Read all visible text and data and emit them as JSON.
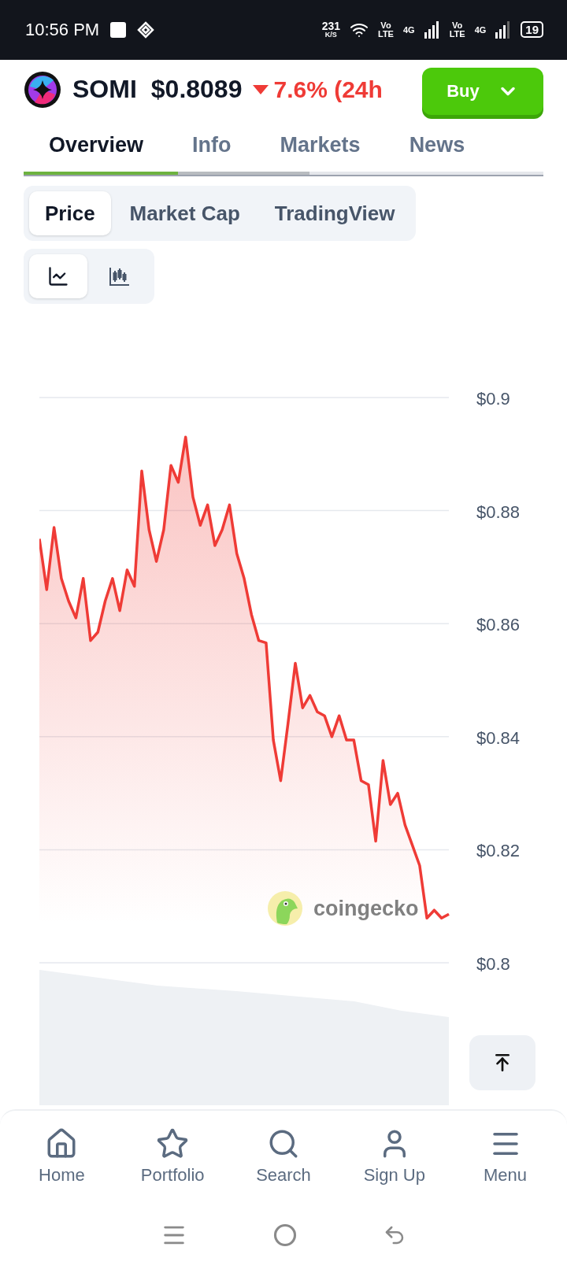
{
  "status_bar": {
    "time": "10:56 PM",
    "speed": "231",
    "speed_unit": "K/S",
    "sim1_top": "Vo",
    "sim1_bottom": "LTE",
    "sim1_net": "4G",
    "sim2_top": "Vo",
    "sim2_bottom": "LTE",
    "sim2_net": "4G",
    "battery": "19"
  },
  "header": {
    "symbol": "SOMI",
    "price": "$0.8089",
    "change": "7.6% (24h",
    "down": true,
    "buy_label": "Buy"
  },
  "tabs": [
    {
      "label": "Overview",
      "selected": true
    },
    {
      "label": "Info",
      "selected": false
    },
    {
      "label": "Markets",
      "selected": false
    },
    {
      "label": "News",
      "selected": false
    }
  ],
  "chart_tabs": [
    {
      "label": "Price",
      "selected": true
    },
    {
      "label": "Market Cap",
      "selected": false
    },
    {
      "label": "TradingView",
      "selected": false
    }
  ],
  "chart_types": [
    {
      "kind": "line",
      "selected": true
    },
    {
      "kind": "candles",
      "selected": false
    }
  ],
  "chart": {
    "brand": "coingecko",
    "chart_data": {
      "type": "area",
      "grid": true,
      "yticks": [
        {
          "value": 0.9,
          "label": "$0.9"
        },
        {
          "value": 0.88,
          "label": "$0.88"
        },
        {
          "value": 0.86,
          "label": "$0.86"
        },
        {
          "value": 0.84,
          "label": "$0.84"
        },
        {
          "value": 0.82,
          "label": "$0.82"
        },
        {
          "value": 0.8,
          "label": "$0.8"
        }
      ],
      "ylim": [
        0.8,
        0.9
      ],
      "series": [
        {
          "color": "#ef3b36",
          "values": [
            0.875,
            0.866,
            0.877,
            0.868,
            0.864,
            0.861,
            0.868,
            0.857,
            0.8585,
            0.864,
            0.868,
            0.8623,
            0.8695,
            0.8666,
            0.887,
            0.8766,
            0.871,
            0.8766,
            0.888,
            0.885,
            0.893,
            0.8824,
            0.8774,
            0.881,
            0.8738,
            0.8766,
            0.881,
            0.8724,
            0.868,
            0.8616,
            0.857,
            0.8566,
            0.8394,
            0.8322,
            0.8423,
            0.853,
            0.8451,
            0.8473,
            0.8444,
            0.8437,
            0.84,
            0.8437,
            0.8394,
            0.8394,
            0.8322,
            0.8315,
            0.8215,
            0.8358,
            0.828,
            0.83,
            0.8244,
            0.8208,
            0.8172,
            0.8079,
            0.8093,
            0.8079,
            0.8086
          ]
        }
      ]
    }
  },
  "nav": [
    {
      "kind": "home",
      "label": "Home"
    },
    {
      "kind": "star",
      "label": "Portfolio"
    },
    {
      "kind": "search",
      "label": "Search"
    },
    {
      "kind": "user",
      "label": "Sign Up"
    },
    {
      "kind": "menu",
      "label": "Menu"
    }
  ]
}
